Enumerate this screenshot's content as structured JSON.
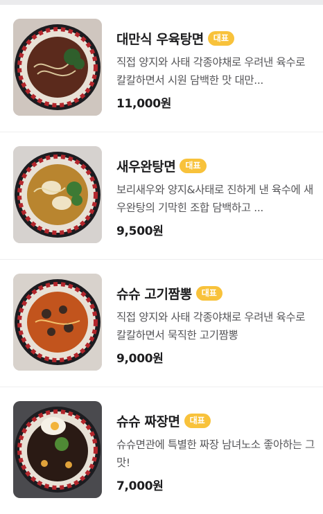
{
  "menu_items": [
    {
      "name": "대만식 우육탕면",
      "badge": "대표",
      "description": "직접 양지와 사태 각종야채로 우려낸 육수로 칼칼하면서 시원 담백한 맛 대만...",
      "price": "11,000원",
      "photo_colors": {
        "broth": "#5b2a1c",
        "topping": "#2f5f2c",
        "accent": "#c8a36a"
      }
    },
    {
      "name": "새우완탕면",
      "badge": "대표",
      "description": "보리새우와 양지&사태로 진하게 낸 육수에 새우완탕의 기막힌 조합 담백하고 ...",
      "price": "9,500원",
      "photo_colors": {
        "broth": "#b9852f",
        "topping": "#3d7a34",
        "accent": "#efe3c4"
      }
    },
    {
      "name": "슈슈 고기짬뽕",
      "badge": "대표",
      "description": "직접 양지와 사태 각종야채로 우려낸 육수로 칼칼하면서 묵직한 고기짬뽕",
      "price": "9,000원",
      "photo_colors": {
        "broth": "#c2541d",
        "topping": "#3b2a22",
        "accent": "#e8b25a"
      }
    },
    {
      "name": "슈슈 짜장면",
      "badge": "대표",
      "description": "슈슈면관에 특별한 짜장 남녀노소 좋아하는 그맛!",
      "price": "7,000원",
      "photo_colors": {
        "broth": "#2a1a14",
        "topping": "#4f8a35",
        "accent": "#f1e6c6"
      }
    }
  ]
}
